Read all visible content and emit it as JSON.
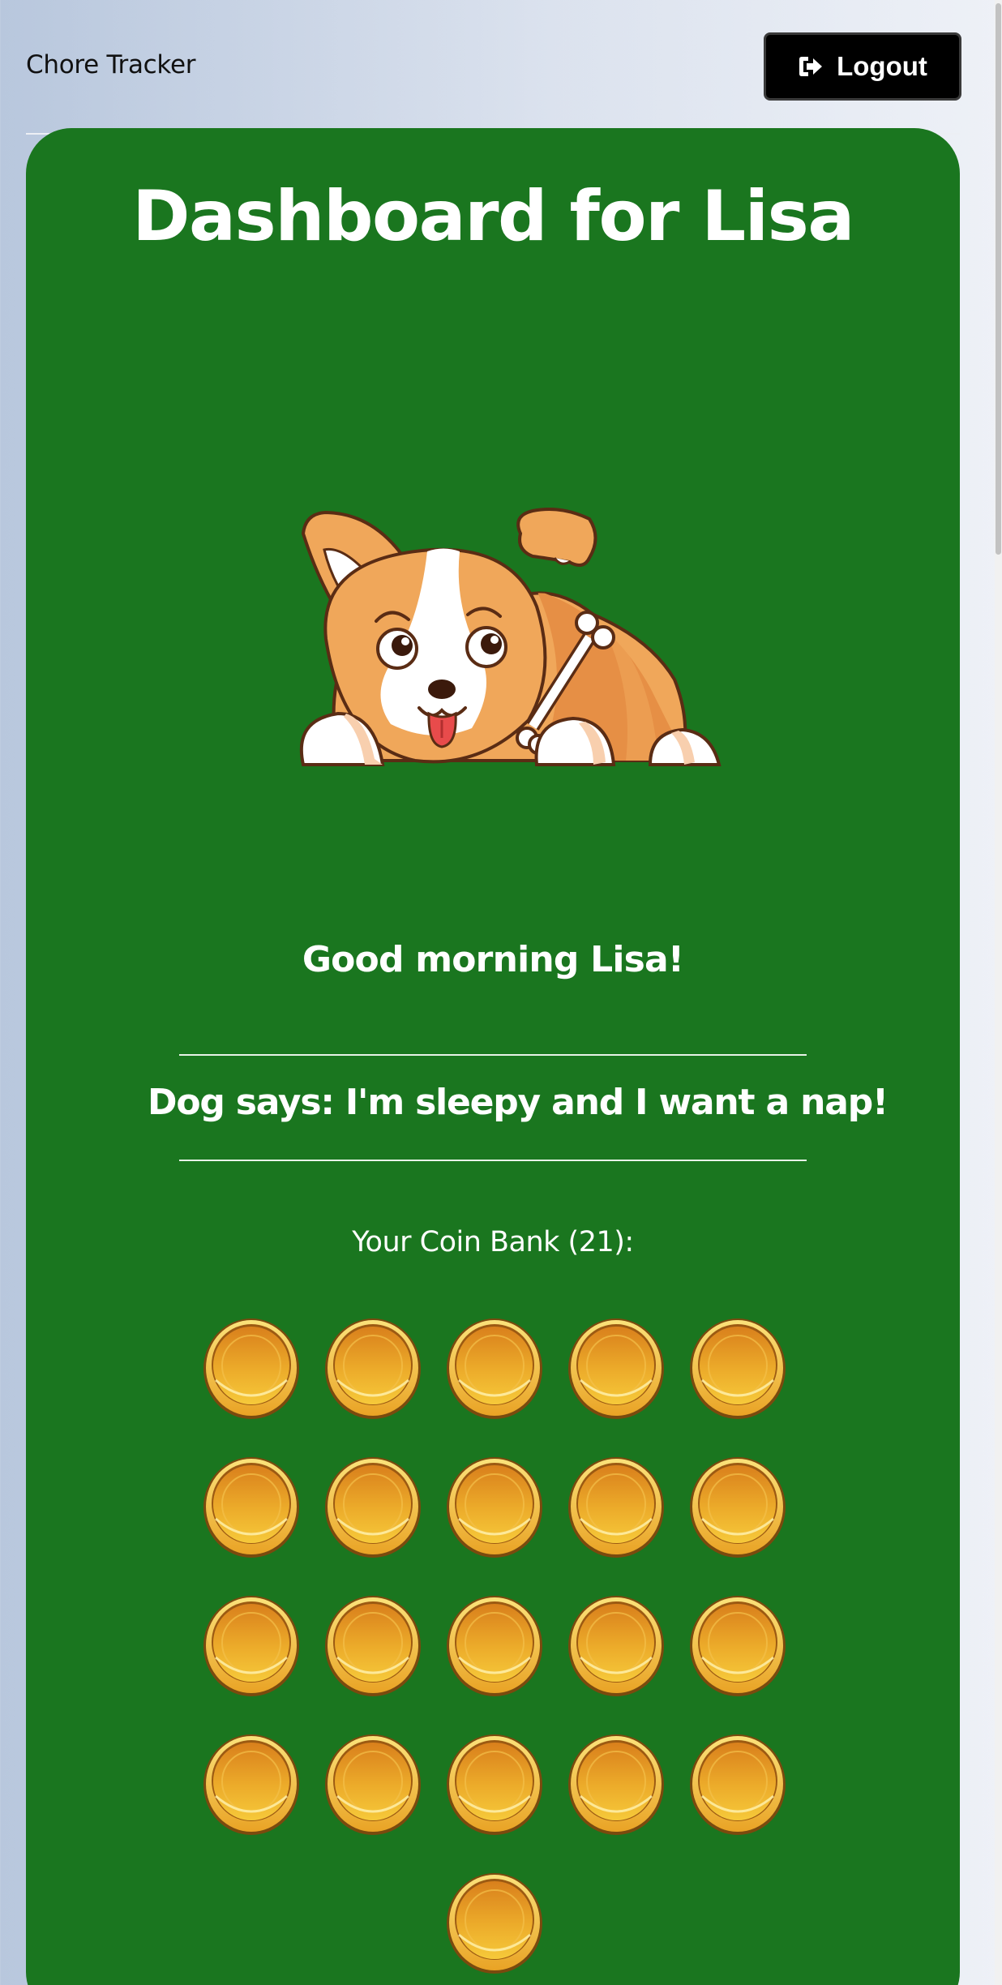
{
  "navbar": {
    "brand": "Chore Tracker",
    "logout_label": "Logout",
    "logout_icon": "sign-out-icon"
  },
  "dashboard": {
    "title": "Dashboard for Lisa",
    "pet_image": "corgi-lying-with-bone",
    "greeting": "Good morning Lisa!",
    "dog_message": "Dog says: I'm sleepy and I want a nap!",
    "coin_bank_label": "Your Coin Bank (21):",
    "coin_count": 21,
    "coins_per_row": 5,
    "coin_icon": "gold-coin-icon"
  },
  "colors": {
    "card_background": "#1a761f",
    "button_background": "#000000",
    "coin_gold": "#f0b82e",
    "text_on_card": "#ffffff"
  }
}
